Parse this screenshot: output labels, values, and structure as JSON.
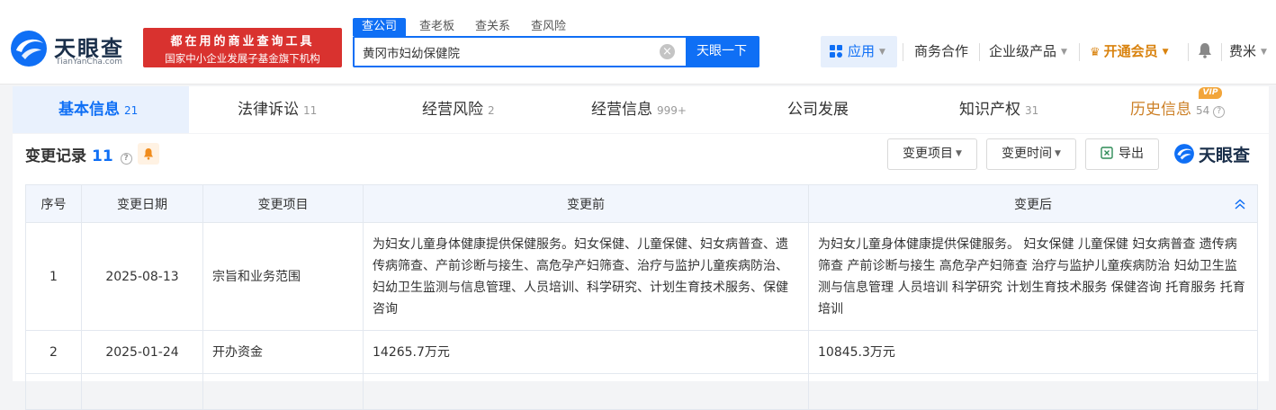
{
  "brand": {
    "name": "天眼查",
    "domain": "TianYanCha.com"
  },
  "slogan": {
    "line1": "都在用的商业查询工具",
    "line2": "国家中小企业发展子基金旗下机构"
  },
  "search": {
    "tabs": [
      "查公司",
      "查老板",
      "查关系",
      "查风险"
    ],
    "value": "黄冈市妇幼保健院",
    "button": "天眼一下"
  },
  "nav": {
    "app": "应用",
    "business": "商务合作",
    "enterprise": "企业级产品",
    "vip": "开通会员",
    "user": "费米"
  },
  "tabs": [
    {
      "label": "基本信息",
      "count": "21"
    },
    {
      "label": "法律诉讼",
      "count": "11"
    },
    {
      "label": "经营风险",
      "count": "2"
    },
    {
      "label": "经营信息",
      "count": "999+"
    },
    {
      "label": "公司发展",
      "count": ""
    },
    {
      "label": "知识产权",
      "count": "31"
    },
    {
      "label": "历史信息",
      "count": "54"
    }
  ],
  "vip_badge": "VIP",
  "section": {
    "title": "变更记录",
    "count": "11",
    "buttons": {
      "item": "变更项目",
      "time": "变更时间",
      "export": "导出"
    },
    "logo": "天眼查"
  },
  "table": {
    "headers": [
      "序号",
      "变更日期",
      "变更项目",
      "变更前",
      "变更后"
    ],
    "rows": [
      {
        "no": "1",
        "date": "2025-08-13",
        "item": "宗旨和业务范围",
        "before": "为妇女儿童身体健康提供保健服务。妇女保健、儿童保健、妇女病普查、遗传病筛查、产前诊断与接生、高危孕产妇筛查、治疗与监护儿童疾病防治、妇幼卫生监测与信息管理、人员培训、科学研究、计划生育技术服务、保健咨询",
        "after": "为妇女儿童身体健康提供保健服务。 妇女保健 儿童保健 妇女病普查 遗传病筛查 产前诊断与接生 高危孕产妇筛查 治疗与监护儿童疾病防治 妇幼卫生监测与信息管理 人员培训 科学研究 计划生育技术服务 保健咨询 托育服务 托育培训"
      },
      {
        "no": "2",
        "date": "2025-01-24",
        "item": "开办资金",
        "before": "14265.7万元",
        "after": "10845.3万元"
      }
    ]
  },
  "colors": {
    "primary": "#0f6ff5",
    "brand_red": "#d9322f",
    "vip": "#d9820d",
    "history": "#cc7f25"
  }
}
